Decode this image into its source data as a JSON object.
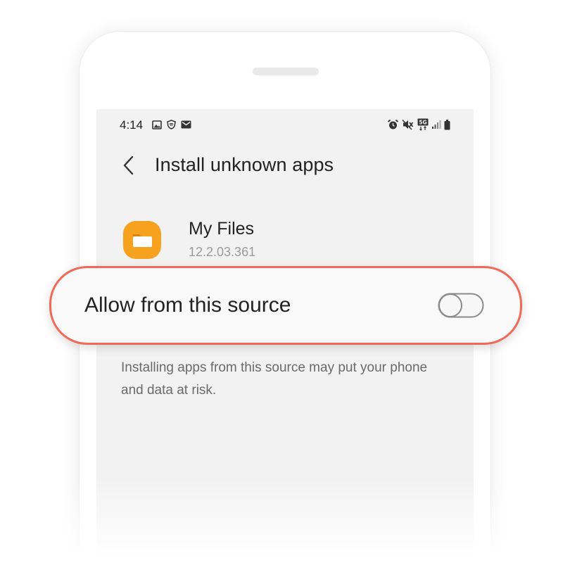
{
  "status_bar": {
    "time": "4:14",
    "left_icons": [
      "gallery-icon",
      "vpn-shield-icon",
      "message-icon"
    ],
    "right_icons": [
      "alarm-icon",
      "mute-icon",
      "5g-icon",
      "signal-icon",
      "battery-icon"
    ],
    "network_label": "5G"
  },
  "header": {
    "title": "Install unknown apps",
    "back_icon": "chevron-left-icon"
  },
  "app": {
    "name": "My Files",
    "version": "12.2.03.361",
    "icon": "folder-icon",
    "icon_color": "#f6a21e"
  },
  "setting": {
    "label": "Allow from this source",
    "enabled": false,
    "highlight_color": "#ef6a58"
  },
  "warning_text": "Installing apps from this source may put your phone and data at risk."
}
